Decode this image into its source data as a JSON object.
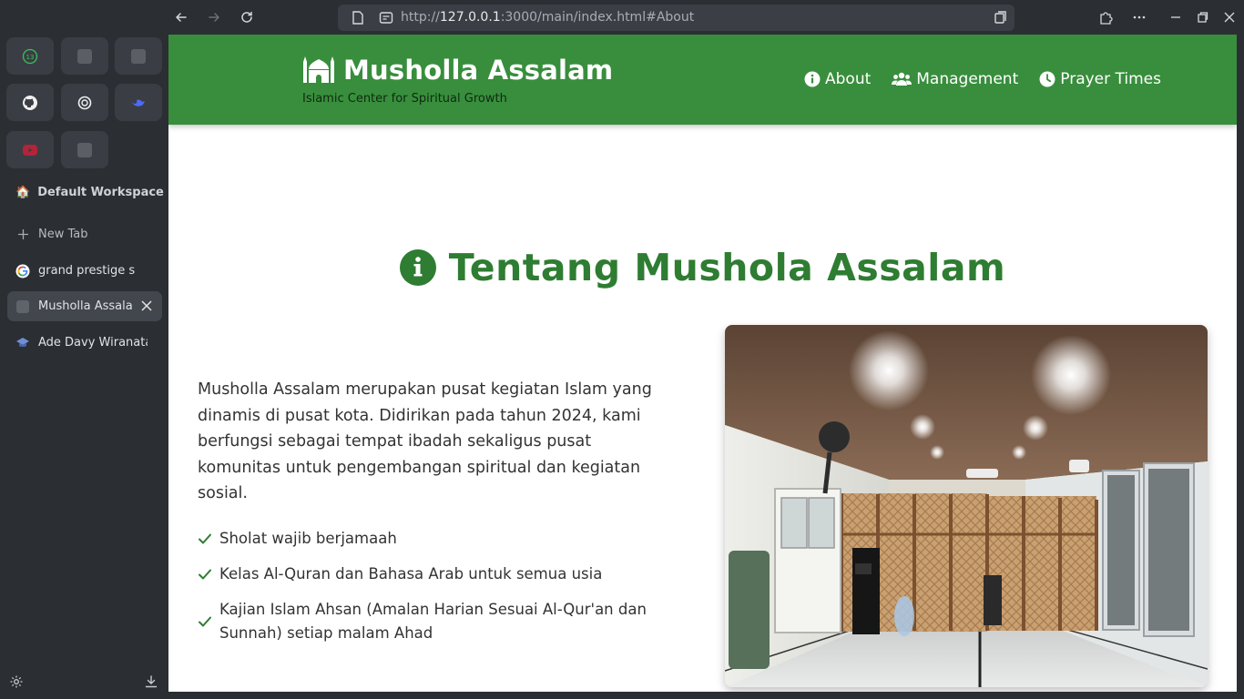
{
  "browser": {
    "url_prefix": "http://",
    "url_host": "127.0.0.1",
    "url_rest": ":3000/main/index.html#About"
  },
  "sidebar": {
    "pinned_badge": "13",
    "workspace": "Default Workspace",
    "new_tab": "New Tab",
    "tabs": [
      {
        "label": "grand prestige sawangan",
        "icon": "google-icon"
      },
      {
        "label": "Musholla Assalam",
        "icon": "page-icon"
      },
      {
        "label": "Ade Davy Wiranata - ",
        "icon": "graduation-cap-icon"
      }
    ]
  },
  "site": {
    "title": "Musholla Assalam",
    "tagline": "Islamic Center for Spiritual Growth",
    "menu": [
      "About",
      "Management",
      "Prayer Times"
    ],
    "section_title": "Tentang Mushola Assalam",
    "paragraph": "Musholla Assalam merupakan pusat kegiatan Islam yang dinamis di pusat kota. Didirikan pada tahun 2024, kami berfungsi sebagai tempat ibadah sekaligus pusat komunitas untuk pengembangan spiritual dan kegiatan sosial.",
    "features": [
      "Sholat wajib berjamaah",
      "Kelas Al-Quran dan Bahasa Arab untuk semua usia",
      "Kajian Islam Ahsan (Amalan Harian Sesuai Al-Qur'an dan Sunnah) setiap malam Ahad"
    ]
  },
  "colors": {
    "header_green": "#388e3c",
    "title_green": "#2e7d32",
    "check_green": "#2e7d32"
  }
}
